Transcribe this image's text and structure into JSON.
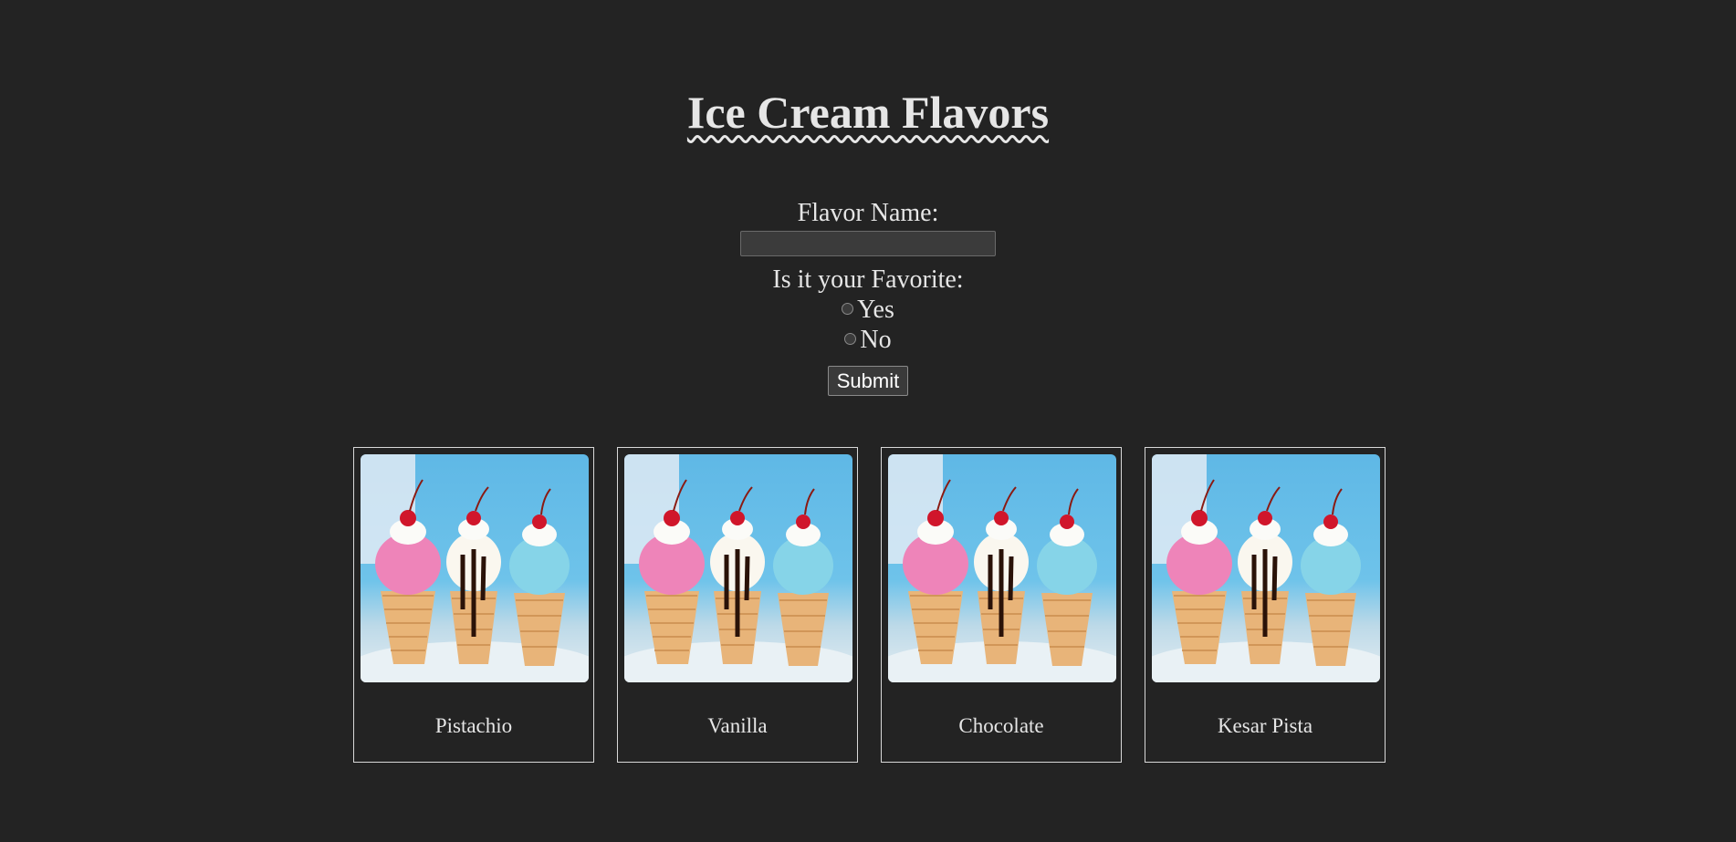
{
  "page": {
    "title": "Ice Cream Flavors"
  },
  "form": {
    "flavor_label": "Flavor Name:",
    "flavor_value": "",
    "favorite_label": "Is it your Favorite:",
    "options": [
      {
        "label": "Yes",
        "selected": false
      },
      {
        "label": "No",
        "selected": false
      }
    ],
    "submit_label": "Submit"
  },
  "cards": [
    {
      "name": "Pistachio",
      "image": "ice-cream-cones-photo"
    },
    {
      "name": "Vanilla",
      "image": "ice-cream-cones-photo"
    },
    {
      "name": "Chocolate",
      "image": "ice-cream-cones-photo"
    },
    {
      "name": "Kesar Pista",
      "image": "ice-cream-cones-photo"
    }
  ],
  "colors": {
    "background": "#232323",
    "text": "#e6e6e6",
    "card_border": "#d8d8d8"
  }
}
